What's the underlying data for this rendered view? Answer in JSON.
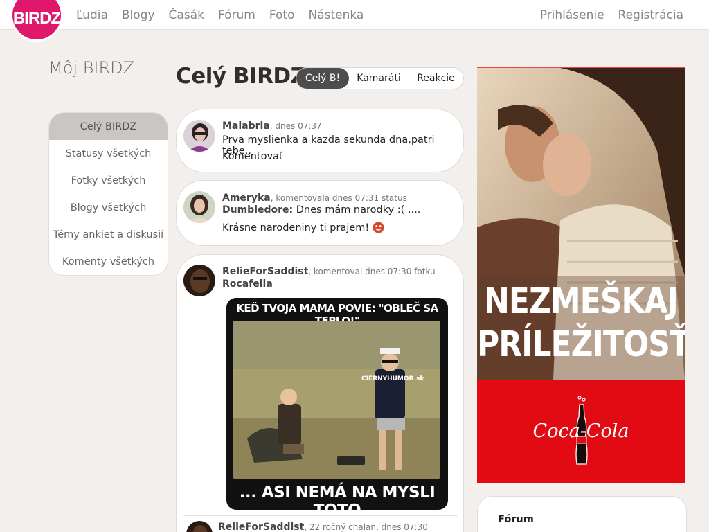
{
  "brand": {
    "logo_text": "BIRDZ",
    "color": "#e0186c"
  },
  "nav": {
    "left": [
      "Ľudia",
      "Blogy",
      "Časák",
      "Fórum",
      "Foto",
      "Nástenka"
    ],
    "right": [
      "Prihlásenie",
      "Registrácia"
    ]
  },
  "sidebar": {
    "title": "Môj BIRDZ",
    "items": [
      {
        "label": "Celý BIRDZ",
        "active": true
      },
      {
        "label": "Statusy všetkých"
      },
      {
        "label": "Fotky všetkých"
      },
      {
        "label": "Blogy všetkých"
      },
      {
        "label": "Témy ankiet a diskusií"
      },
      {
        "label": "Komenty všetkých"
      }
    ]
  },
  "main": {
    "title": "Celý BIRDZ",
    "tabs": [
      {
        "label": "Celý B!",
        "active": true
      },
      {
        "label": "Kamaráti"
      },
      {
        "label": "Reakcie"
      }
    ]
  },
  "feed": [
    {
      "user": "Malabria",
      "meta": ", dnes 07:37",
      "text": "Prva myslienka a kazda sekunda dna,patri tebe..",
      "action": "Komentovať"
    },
    {
      "user": "Ameryka",
      "meta": ", komentovala dnes 07:31 status",
      "target_user": "Dumbledore:",
      "text": " Dnes mám narodky :( ....",
      "comment": "Krásne narodeniny ti prajem!"
    },
    {
      "user": "RelieForSaddist",
      "meta": ", komentoval dnes 07:30 fotku",
      "target_user": "Rocafella",
      "meme_top": "KEĎ TVOJA MAMA POVIE: \"OBLEČ SA TEPLO!\"",
      "meme_bottom": "... ASI NEMÁ NA MYSLI TOTO",
      "meme_watermark": "CIERNYHUMOR.sk",
      "reply_user": "RelieForSaddist",
      "reply_meta": ", 22 ročný chalan, dnes 07:30"
    }
  ],
  "ad": {
    "headline_1": "NEZMEŠKAJ",
    "headline_2": "PRÍLEŽITOSŤ.",
    "brand": "Coca-Cola",
    "red": "#e20b14"
  },
  "forum_box": {
    "title": "Fórum"
  }
}
